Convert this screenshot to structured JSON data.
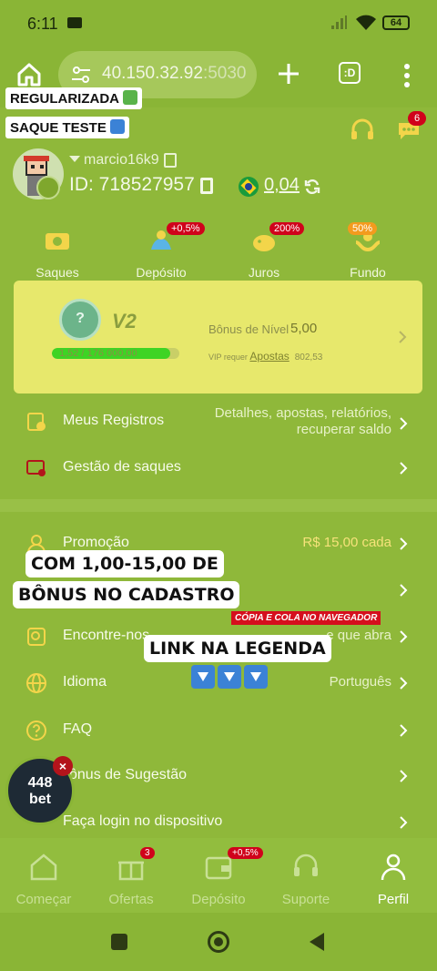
{
  "status_bar": {
    "time": "6:11",
    "battery": "64"
  },
  "browser": {
    "url_host": "40.150.32.92",
    "url_port": ":5030",
    "tabs_label": ":D"
  },
  "stickers": {
    "regularizada": "REGULARIZADA",
    "saque_teste": "SAQUE TESTE"
  },
  "header": {
    "chat_badge": "6"
  },
  "profile": {
    "username": "marcio16k9",
    "user_id": "ID: 718527957",
    "balance": "0,04"
  },
  "quick_actions": [
    {
      "label": "Saques",
      "badge": ""
    },
    {
      "label": "Depósito",
      "badge": "+0,5%"
    },
    {
      "label": "Juros",
      "badge": "200%"
    },
    {
      "label": "Fundo",
      "badge": "50%"
    }
  ],
  "vip": {
    "medal": "?",
    "level": "V2",
    "progress_text": "1,52 / 176 000,00",
    "progress": 0.93,
    "bonus_label": "Bônus de Nível",
    "bonus_value": "5,00",
    "req_prefix": "VIP requer",
    "req_link": "Apostas",
    "req_value": "802,53"
  },
  "menu": {
    "registros": {
      "label": "Meus Registros",
      "value_line1": "Detalhes, apostas, relatórios,",
      "value_line2": "recuperar saldo"
    },
    "saques": {
      "label": "Gestão de saques"
    },
    "promocao": {
      "label": "Promoção",
      "value": "R$ 15,00 cada"
    },
    "encontre": {
      "label": "Encontre-nos",
      "value": "e que abra"
    },
    "idioma": {
      "label": "Idioma",
      "value": "Português"
    },
    "faq": {
      "label": "FAQ"
    },
    "sugestao": {
      "label": "ônus de Sugestão"
    },
    "login": {
      "label": "Faça login no dispositivo"
    }
  },
  "overlays": {
    "bonus_line1": "COM 1,00-15,00 DE",
    "bonus_line2": "BÔNUS NO CADASTRO",
    "copy_tag": "CÓPIA E COLA NO NAVEGADOR",
    "link_legenda": "LINK NA LEGENDA",
    "bubble_num": "448",
    "bubble_word": "bet",
    "bubble_close": "×"
  },
  "bottom_nav": [
    {
      "label": "Começar",
      "badge": ""
    },
    {
      "label": "Ofertas",
      "badge": "3"
    },
    {
      "label": "Depósito",
      "badge": "+0,5%"
    },
    {
      "label": "Suporte",
      "badge": ""
    },
    {
      "label": "Perfil",
      "badge": ""
    }
  ]
}
